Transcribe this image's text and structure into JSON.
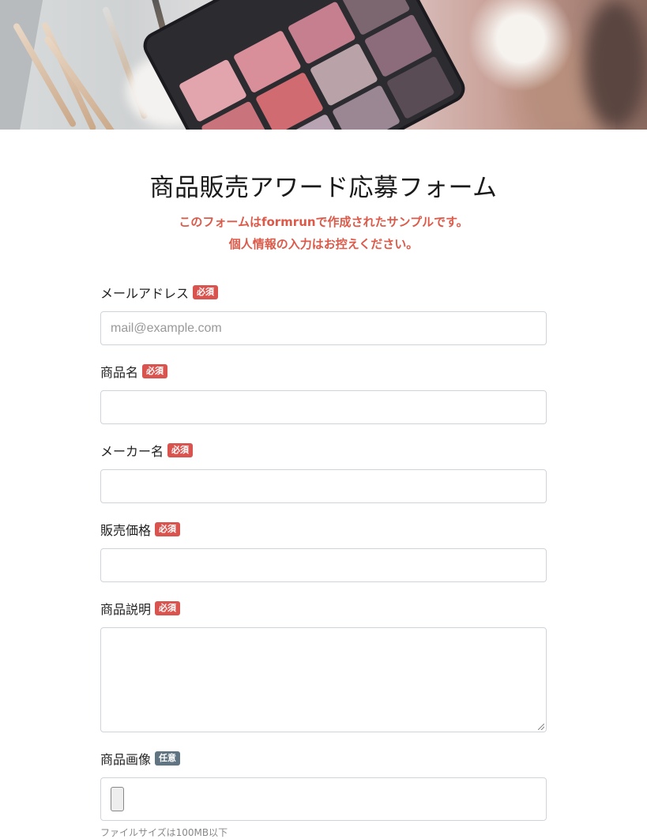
{
  "form": {
    "title": "商品販売アワード応募フォーム",
    "notice_line1": "このフォームはformrunで作成されたサンプルです。",
    "notice_line2": "個人情報の入力はお控えください。"
  },
  "badges": {
    "required": "必須",
    "optional": "任意"
  },
  "fields": [
    {
      "label": "メールアドレス",
      "placeholder": "mail@example.com",
      "value": ""
    },
    {
      "label": "商品名",
      "placeholder": "",
      "value": ""
    },
    {
      "label": "メーカー名",
      "placeholder": "",
      "value": ""
    },
    {
      "label": "販売価格",
      "placeholder": "",
      "value": ""
    },
    {
      "label": "商品説明",
      "placeholder": "",
      "value": ""
    },
    {
      "label": "商品画像",
      "placeholder": "",
      "value": ""
    }
  ],
  "file_hint": "ファイルサイズは100MB以下"
}
